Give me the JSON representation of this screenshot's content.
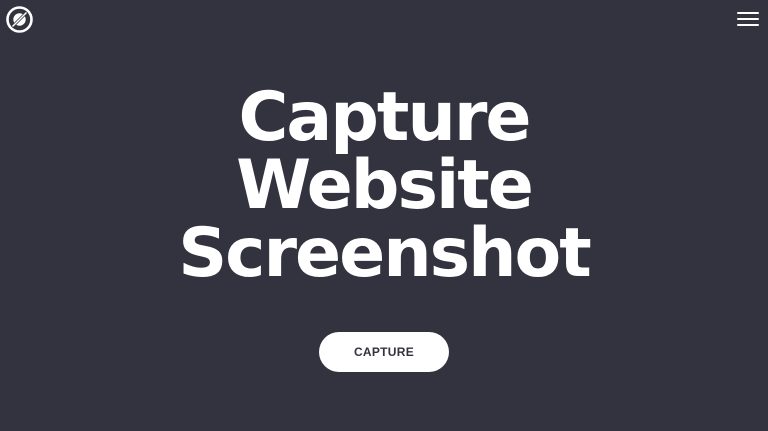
{
  "header": {
    "logo_icon": "slashed-circle-logo-icon",
    "menu_icon": "hamburger-menu-icon"
  },
  "hero": {
    "title_lines": [
      "Capture",
      "Website",
      "Screenshot"
    ]
  },
  "cta": {
    "capture_label": "CAPTURE"
  },
  "colors": {
    "background": "#33323f",
    "text": "#ffffff",
    "button_bg": "#ffffff",
    "button_text": "#33323f"
  }
}
